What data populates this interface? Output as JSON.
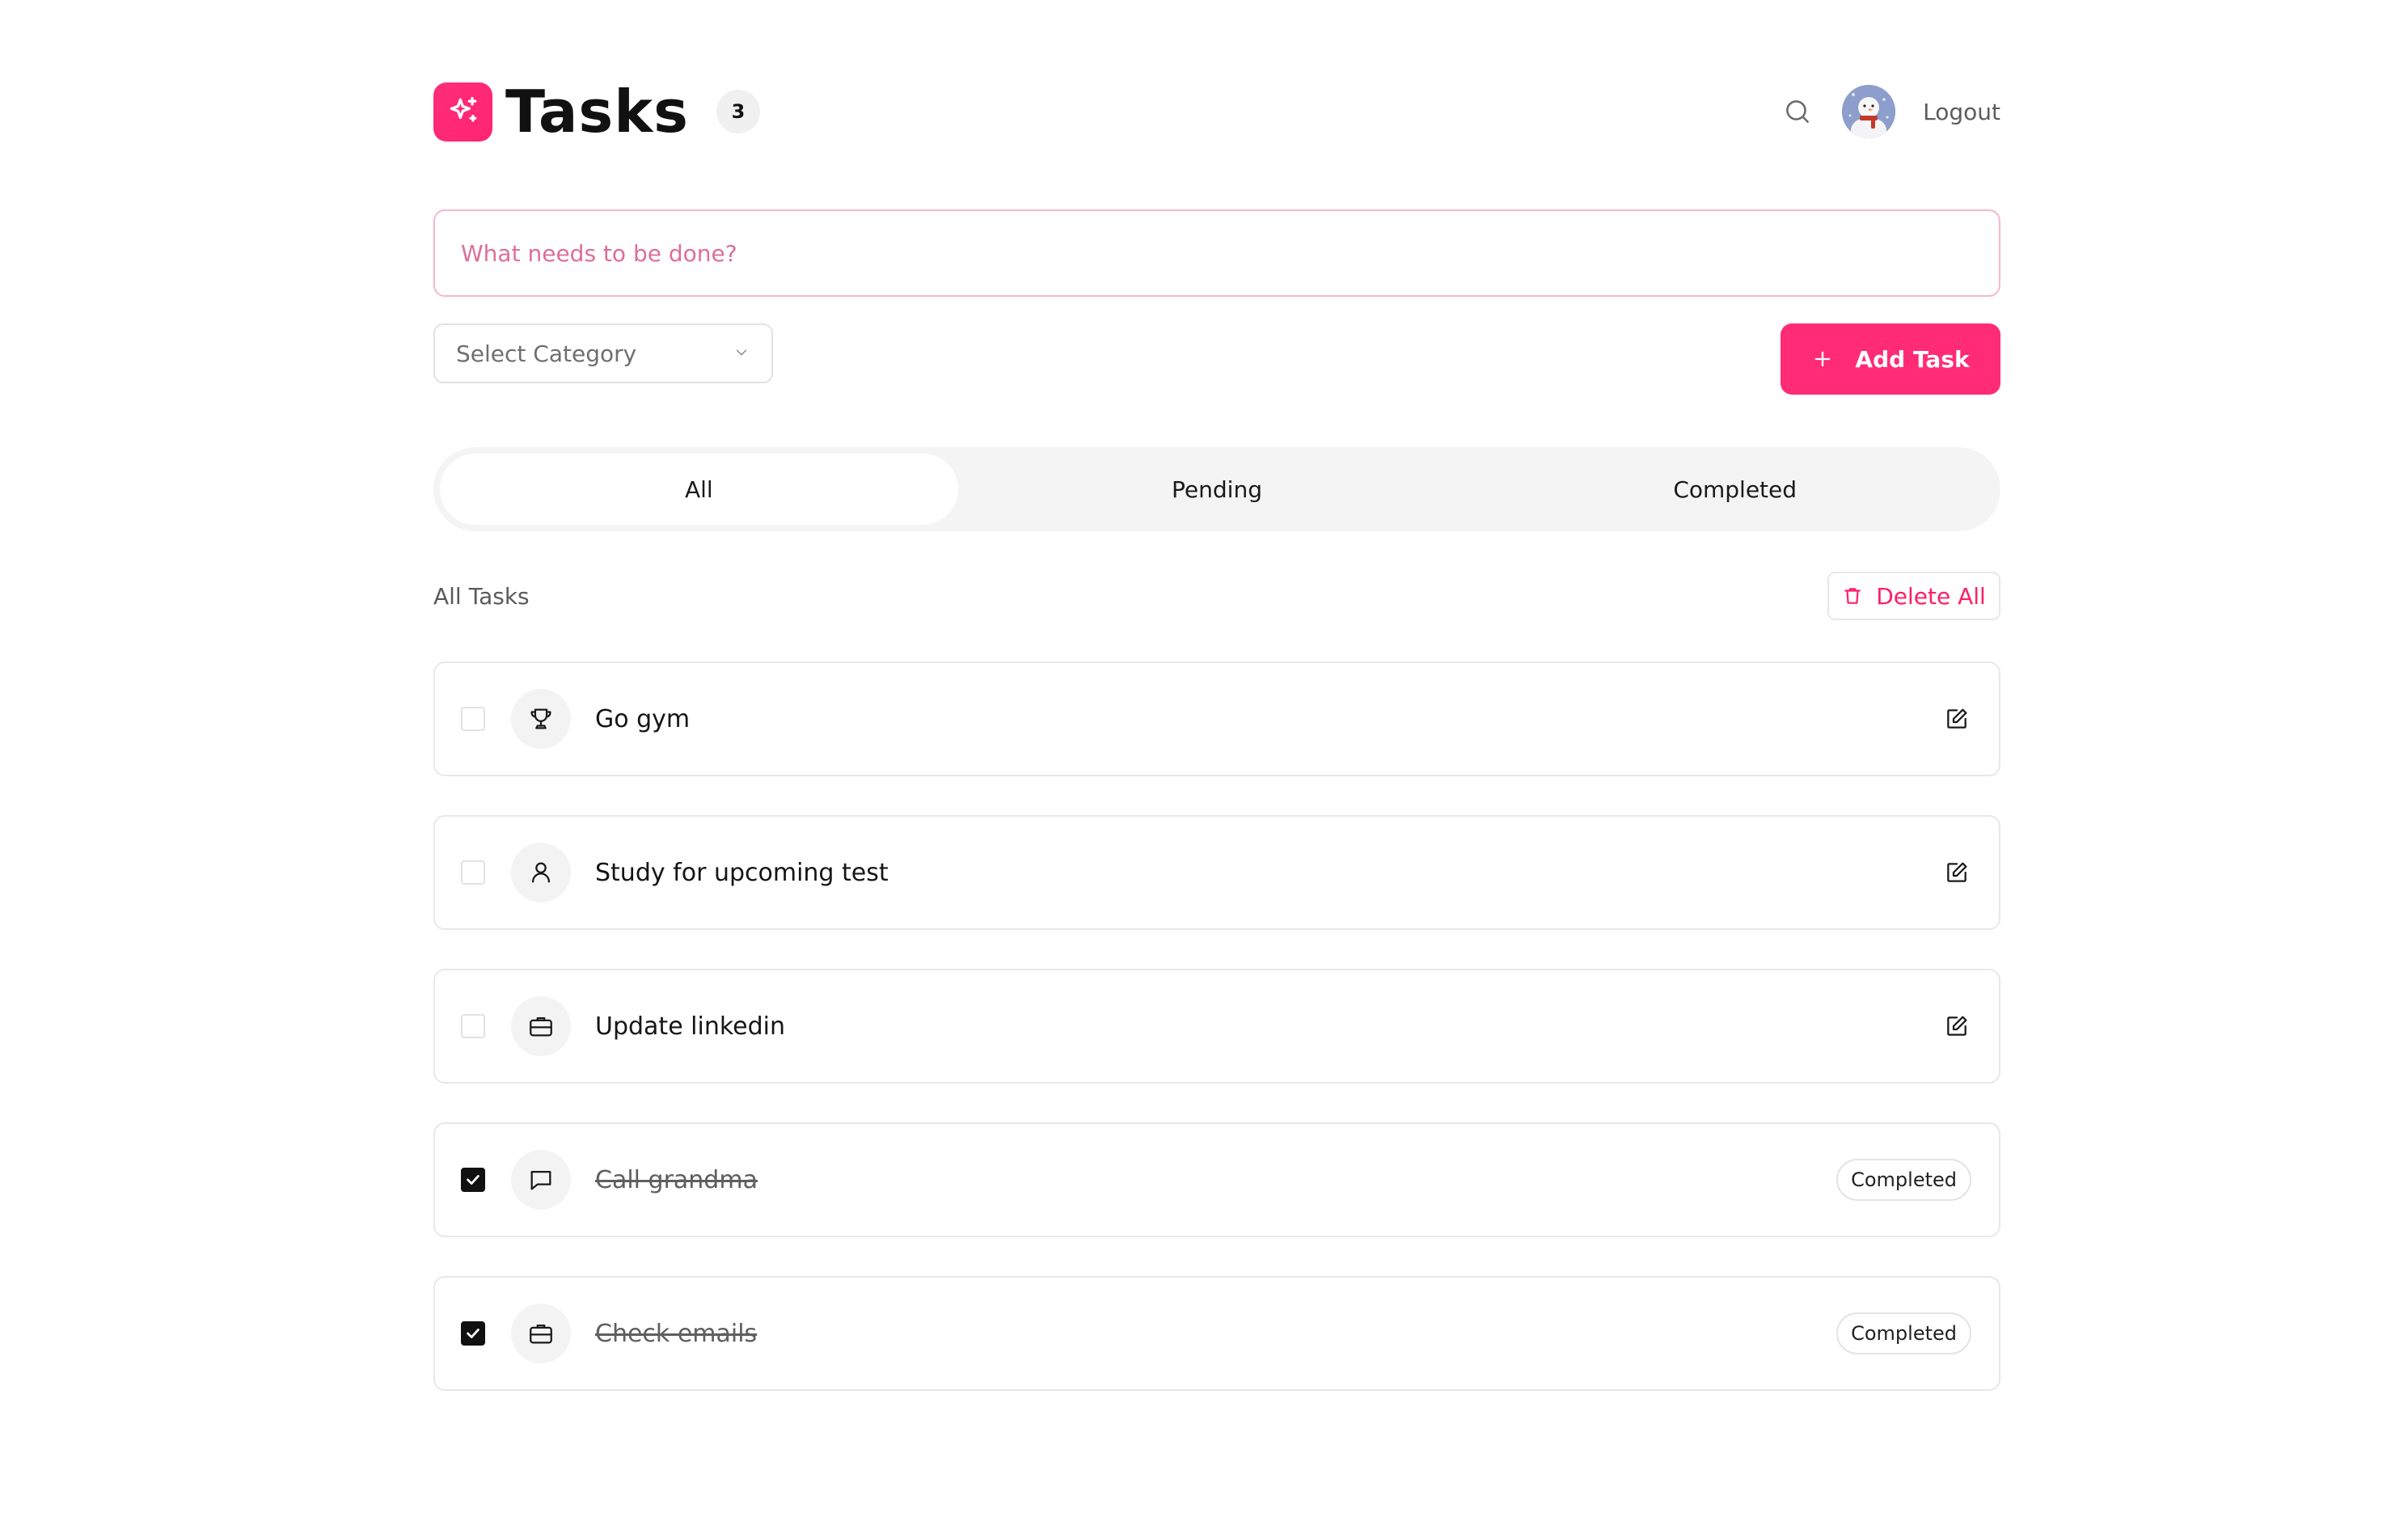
{
  "header": {
    "title": "Tasks",
    "count": "3",
    "logout_label": "Logout",
    "logo_icon": "sparkles-icon",
    "search_icon": "search-icon"
  },
  "input": {
    "placeholder": "What needs to be done?"
  },
  "category_select": {
    "selected": "Select Category"
  },
  "add_button": {
    "label": "Add Task"
  },
  "tabs": [
    {
      "label": "All",
      "active": true
    },
    {
      "label": "Pending",
      "active": false
    },
    {
      "label": "Completed",
      "active": false
    }
  ],
  "section": {
    "title": "All Tasks",
    "delete_all_label": "Delete All"
  },
  "tasks": [
    {
      "title": "Go gym",
      "icon": "trophy-icon",
      "completed": false
    },
    {
      "title": "Study for upcoming test",
      "icon": "user-icon",
      "completed": false
    },
    {
      "title": "Update linkedin",
      "icon": "briefcase-icon",
      "completed": false
    },
    {
      "title": "Call grandma",
      "icon": "message-icon",
      "completed": true,
      "status": "Completed"
    },
    {
      "title": "Check emails",
      "icon": "briefcase-icon",
      "completed": true,
      "status": "Completed"
    }
  ],
  "colors": {
    "accent": "#ff2b74",
    "input_border": "#f7b7cc",
    "placeholder": "#de6f95",
    "delete": "#ff1f66"
  }
}
